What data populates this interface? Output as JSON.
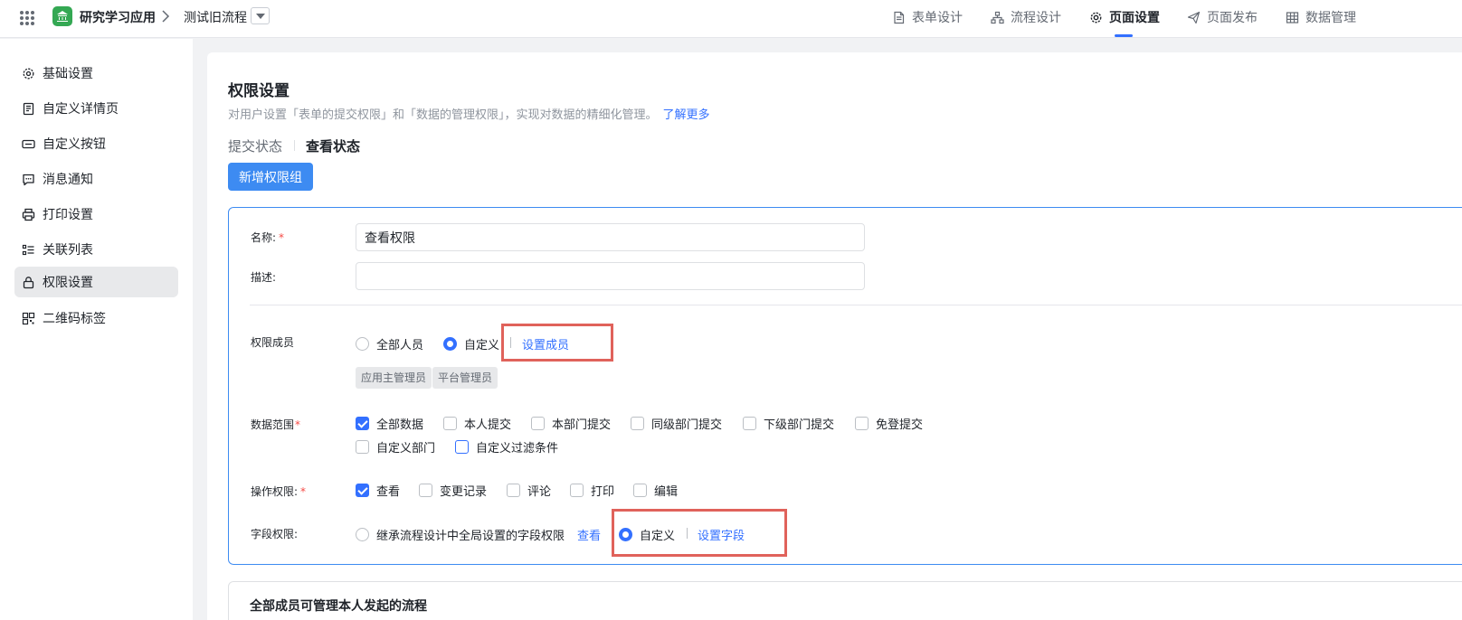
{
  "header": {
    "app_name": "研究学习应用",
    "breadcrumb_sep": "›",
    "flow_name": "测试旧流程",
    "nav": [
      {
        "label": "表单设计",
        "icon": "document-icon"
      },
      {
        "label": "流程设计",
        "icon": "flow-icon"
      },
      {
        "label": "页面设置",
        "icon": "gear-icon",
        "active": true
      },
      {
        "label": "页面发布",
        "icon": "send-icon"
      },
      {
        "label": "数据管理",
        "icon": "table-icon"
      }
    ]
  },
  "sidebar": {
    "items": [
      {
        "label": "基础设置",
        "icon": "gear-icon"
      },
      {
        "label": "自定义详情页",
        "icon": "detail-page-icon"
      },
      {
        "label": "自定义按钮",
        "icon": "button-icon"
      },
      {
        "label": "消息通知",
        "icon": "message-icon"
      },
      {
        "label": "打印设置",
        "icon": "printer-icon"
      },
      {
        "label": "关联列表",
        "icon": "list-icon"
      },
      {
        "label": "权限设置",
        "icon": "lock-icon",
        "active": true
      },
      {
        "label": "二维码标签",
        "icon": "qrcode-icon"
      }
    ]
  },
  "main": {
    "title": "权限设置",
    "subtitle": "对用户设置「表单的提交权限」和「数据的管理权限」，实现对数据的精细化管理。",
    "learn_more": "了解更多",
    "tabs": [
      {
        "label": "提交状态",
        "active": false
      },
      {
        "label": "查看状态",
        "active": true
      }
    ],
    "add_group_button": "新增权限组",
    "group": {
      "name_label": "名称:",
      "name_value": "查看权限",
      "desc_label": "描述:",
      "desc_value": "",
      "members": {
        "label": "权限成员",
        "options": [
          {
            "label": "全部人员",
            "selected": false
          },
          {
            "label": "自定义",
            "selected": true
          }
        ],
        "set_members_link": "设置成员",
        "tags": [
          "应用主管理员",
          "平台管理员"
        ]
      },
      "data_scope": {
        "label": "数据范围",
        "options": [
          {
            "label": "全部数据",
            "checked": true
          },
          {
            "label": "本人提交",
            "checked": false
          },
          {
            "label": "本部门提交",
            "checked": false
          },
          {
            "label": "同级部门提交",
            "checked": false
          },
          {
            "label": "下级部门提交",
            "checked": false
          },
          {
            "label": "免登提交",
            "checked": false
          },
          {
            "label": "自定义部门",
            "checked": false
          },
          {
            "label": "自定义过滤条件",
            "checked": false
          }
        ]
      },
      "operations": {
        "label": "操作权限:",
        "options": [
          {
            "label": "查看",
            "checked": true
          },
          {
            "label": "变更记录",
            "checked": false
          },
          {
            "label": "评论",
            "checked": false
          },
          {
            "label": "打印",
            "checked": false
          },
          {
            "label": "编辑",
            "checked": false
          }
        ]
      },
      "fields": {
        "label": "字段权限:",
        "inherit_option": "继承流程设计中全局设置的字段权限",
        "view_link": "查看",
        "custom_option": "自定义",
        "set_fields_link": "设置字段"
      }
    },
    "next_group_title": "全部成员可管理本人发起的流程"
  },
  "colors": {
    "accent": "#3370ff",
    "button": "#3d8bf2",
    "highlight": "#e0625b",
    "required": "#f54a45"
  }
}
